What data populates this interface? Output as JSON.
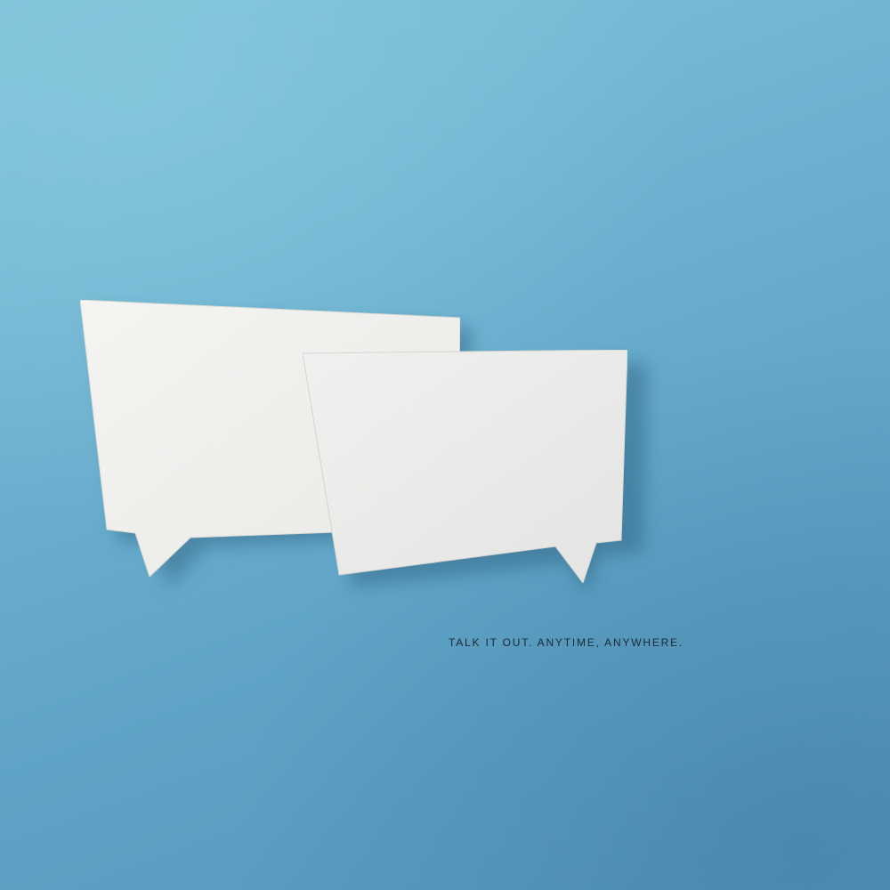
{
  "scene": {
    "background_color": "#6db1d0",
    "paper_color": "#f4f4f2",
    "tagline": "TALK IT OUT. ANYTIME, ANYWHERE."
  }
}
